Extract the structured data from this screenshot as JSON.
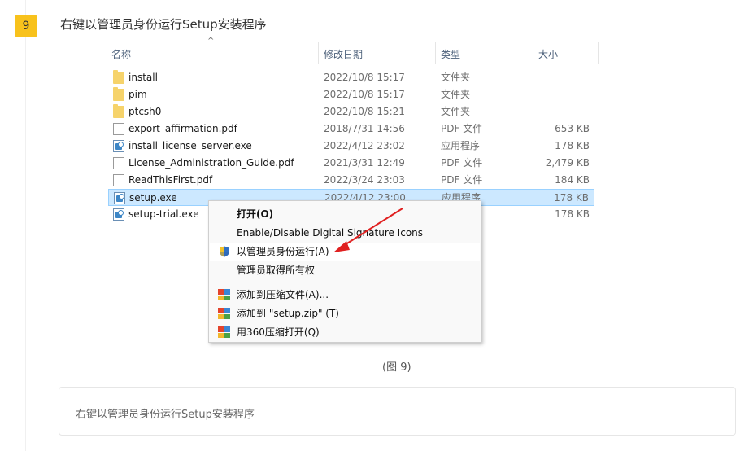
{
  "step": {
    "number": "9",
    "title": "右键以管理员身份运行Setup安装程序",
    "badge_color": "#f8c21c"
  },
  "explorer": {
    "sort_indicator": "^",
    "columns": {
      "name": "名称",
      "modified": "修改日期",
      "type": "类型",
      "size": "大小"
    },
    "files": [
      {
        "name": "install",
        "date": "2022/10/8 15:17",
        "type": "文件夹",
        "size": "",
        "icon": "folder-icon"
      },
      {
        "name": "pim",
        "date": "2022/10/8 15:17",
        "type": "文件夹",
        "size": "",
        "icon": "folder-icon"
      },
      {
        "name": "ptcsh0",
        "date": "2022/10/8 15:21",
        "type": "文件夹",
        "size": "",
        "icon": "folder-icon"
      },
      {
        "name": "export_affirmation.pdf",
        "date": "2018/7/31 14:56",
        "type": "PDF 文件",
        "size": "653 KB",
        "icon": "document-icon"
      },
      {
        "name": "install_license_server.exe",
        "date": "2022/4/12 23:02",
        "type": "应用程序",
        "size": "178 KB",
        "icon": "exe-icon"
      },
      {
        "name": "License_Administration_Guide.pdf",
        "date": "2021/3/31 12:49",
        "type": "PDF 文件",
        "size": "2,479 KB",
        "icon": "document-icon"
      },
      {
        "name": "ReadThisFirst.pdf",
        "date": "2022/3/24 23:03",
        "type": "PDF 文件",
        "size": "184 KB",
        "icon": "document-icon"
      },
      {
        "name": "setup.exe",
        "date": "2022/4/12 23:00",
        "type": "应用程序",
        "size": "178 KB",
        "icon": "exe-icon",
        "selected": true
      },
      {
        "name": "setup-trial.exe",
        "date": "",
        "type": "",
        "size": "178 KB",
        "icon": "exe-icon"
      }
    ]
  },
  "context_menu": {
    "items": [
      {
        "label": "打开(O)",
        "bold": true
      },
      {
        "label": "Enable/Disable Digital Signature Icons"
      },
      {
        "label": "以管理员身份运行(A)",
        "icon": "uac-shield-icon"
      },
      {
        "label": "管理员取得所有权"
      },
      {
        "label": "添加到压缩文件(A)...",
        "icon": "archive-icon"
      },
      {
        "label": "添加到 \"setup.zip\" (T)",
        "icon": "archive-icon"
      },
      {
        "label": "用360压缩打开(Q)",
        "icon": "archive-icon"
      }
    ]
  },
  "annotation_arrow_color": "#e02020",
  "caption": "(图 9)",
  "note": "右键以管理员身份运行Setup安装程序"
}
